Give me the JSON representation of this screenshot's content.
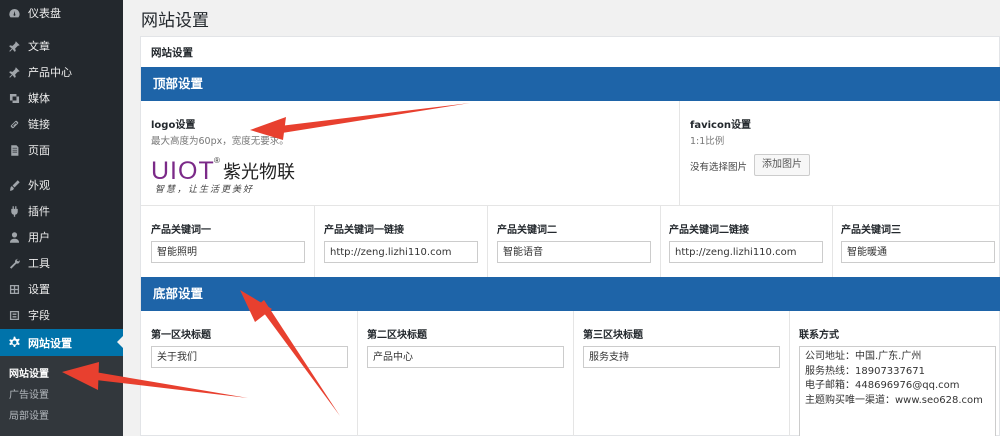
{
  "sidebar": {
    "items": [
      {
        "label": "仪表盘",
        "icon": "dashboard-icon"
      },
      {
        "label": "文章",
        "icon": "pin-icon"
      },
      {
        "label": "产品中心",
        "icon": "pin-icon"
      },
      {
        "label": "媒体",
        "icon": "media-icon"
      },
      {
        "label": "链接",
        "icon": "link-icon"
      },
      {
        "label": "页面",
        "icon": "page-icon"
      },
      {
        "label": "外观",
        "icon": "brush-icon"
      },
      {
        "label": "插件",
        "icon": "plugin-icon"
      },
      {
        "label": "用户",
        "icon": "user-icon"
      },
      {
        "label": "工具",
        "icon": "wrench-icon"
      },
      {
        "label": "设置",
        "icon": "settings-icon"
      },
      {
        "label": "字段",
        "icon": "fields-icon"
      },
      {
        "label": "网站设置",
        "icon": "gear-icon"
      }
    ],
    "submenu": [
      "网站设置",
      "广告设置",
      "局部设置"
    ]
  },
  "page": {
    "title": "网站设置",
    "panel_title": "网站设置"
  },
  "top_section": {
    "title": "顶部设置",
    "logo": {
      "label": "logo设置",
      "desc": "最大高度为60px，宽度无要求。",
      "brand": "UIOT",
      "brand_cn": "紫光物联",
      "reg": "®",
      "slogan": "智慧，让生活更美好"
    },
    "favicon": {
      "label": "favicon设置",
      "desc": "1:1比例",
      "no_image": "没有选择图片",
      "button": "添加图片"
    },
    "keywords": [
      {
        "label": "产品关键词一",
        "value": "智能照明"
      },
      {
        "label": "产品关键词一链接",
        "value": "http://zeng.lizhi110.com"
      },
      {
        "label": "产品关键词二",
        "value": "智能语音"
      },
      {
        "label": "产品关键词二链接",
        "value": "http://zeng.lizhi110.com"
      },
      {
        "label": "产品关键词三",
        "value": "智能暖通"
      }
    ]
  },
  "bottom_section": {
    "title": "底部设置",
    "blocks": [
      {
        "label": "第一区块标题",
        "value": "关于我们"
      },
      {
        "label": "第二区块标题",
        "value": "产品中心"
      },
      {
        "label": "第三区块标题",
        "value": "服务支持"
      }
    ],
    "contact": {
      "label": "联系方式",
      "value": "公司地址：中国.广东.广州\n服务热线：18907337671\n电子邮箱：448696976@qq.com\n主题购买唯一渠道：www.seo628.com"
    }
  },
  "colors": {
    "sidebar_bg": "#23282d",
    "accent": "#0073aa",
    "section_bar": "#1e64a8",
    "arrow": "#e8402f",
    "brand_purple": "#7b2a88"
  }
}
